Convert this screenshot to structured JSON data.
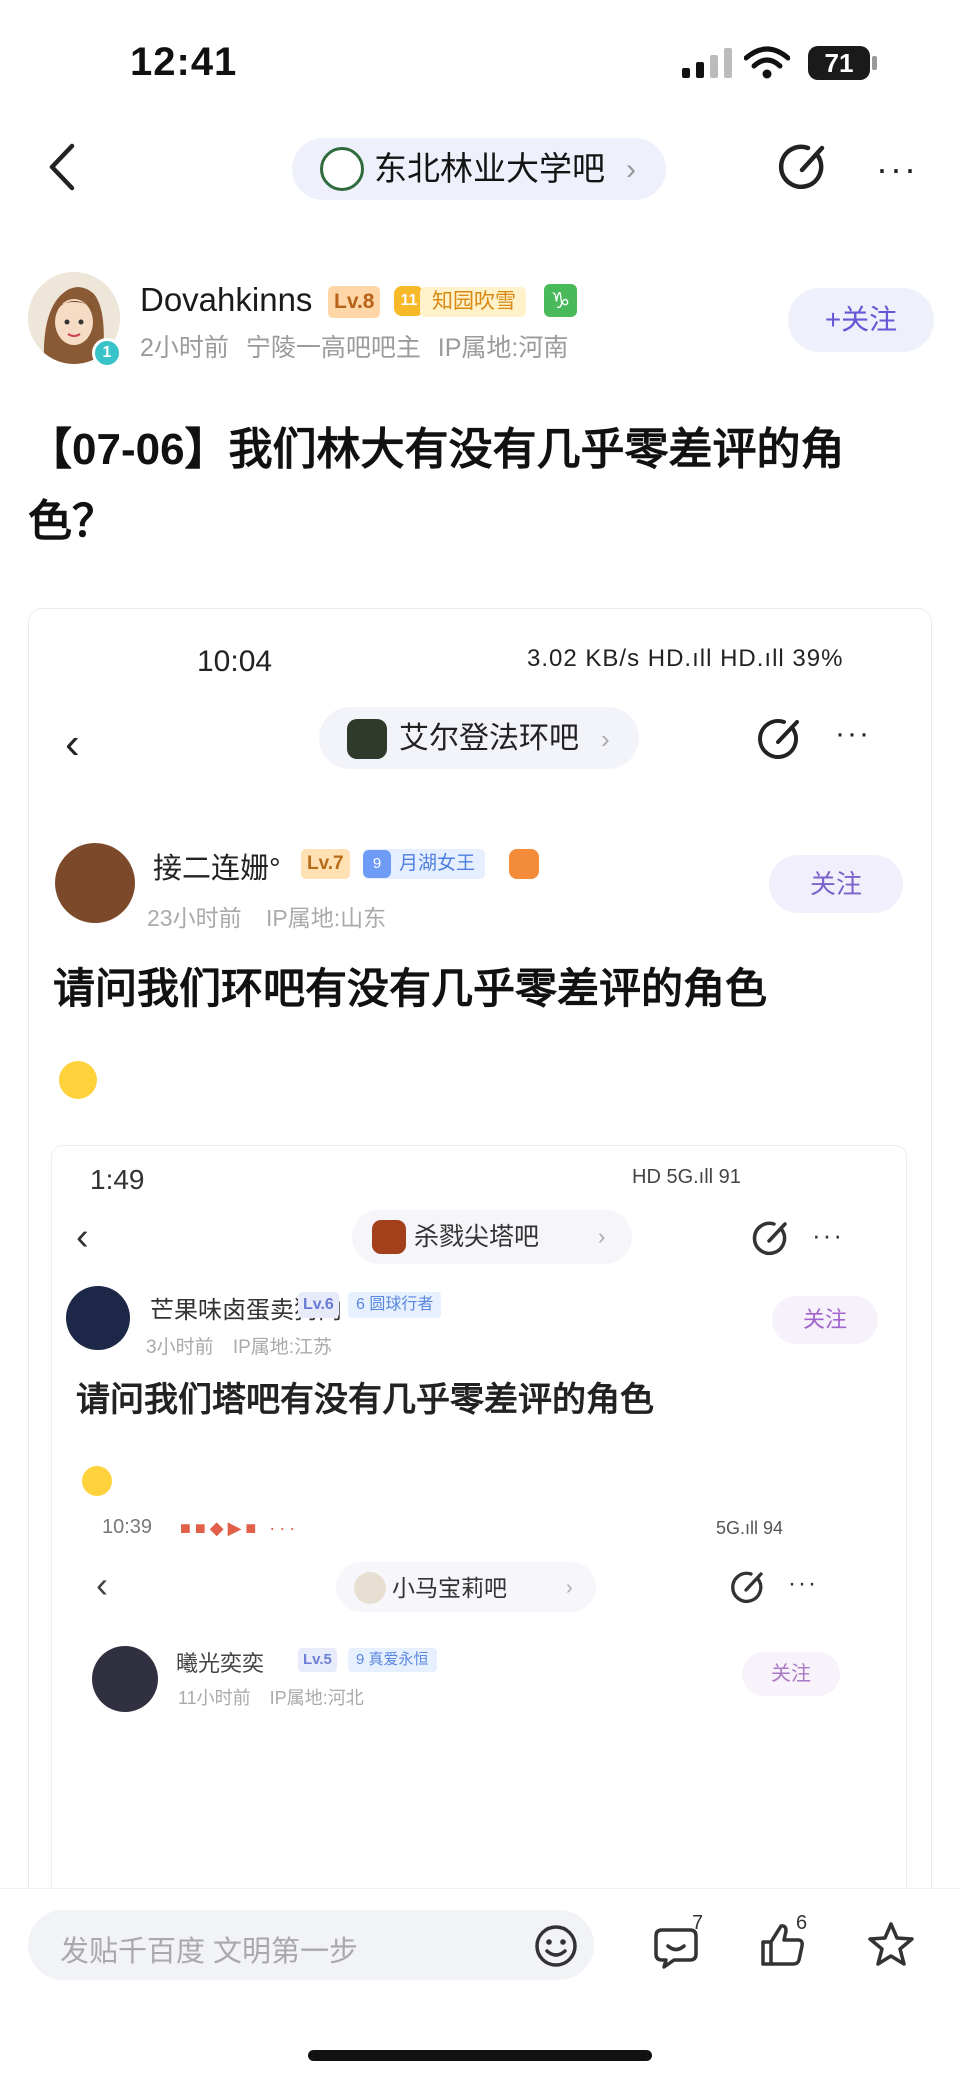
{
  "status_bar": {
    "time": "12:41",
    "battery": "71"
  },
  "nav": {
    "forum_name": "东北林业大学吧",
    "chevron": "›",
    "more": "···"
  },
  "author": {
    "name": "Dovahkinns",
    "level": "Lv.8",
    "medal_num": "11",
    "title_badge": "知园吹雪",
    "zodiac": "♑",
    "avatar_badge": "1",
    "meta": "2小时前  宁陵一高吧吧主  IP属地:河南",
    "follow_label": "+关注"
  },
  "post": {
    "title": "【07-06】我们林大有没有几乎零差评的角色？"
  },
  "screenshot1": {
    "time": "10:04",
    "status": "3.02 KB/s  HD.ıll HD.ıll  39%",
    "back": "‹",
    "forum_name": "艾尔登法环吧",
    "chevron": "›",
    "more": "···",
    "name": "接二连姗°",
    "level": "Lv.7",
    "tag_num": "9",
    "tag": "月湖女王",
    "meta": "23小时前 IP属地:山东",
    "follow_label": "关注",
    "title": "请问我们环吧有没有几乎零差评的角色"
  },
  "screenshot2": {
    "time": "1:49",
    "status": "HD 5G.ıll  91",
    "back": "‹",
    "forum_name": "杀戮尖塔吧",
    "chevron": "›",
    "more": "···",
    "name": "芒果味卤蛋卖狗肉",
    "level": "Lv.6",
    "tag": "6 圆球行者",
    "meta": "3小时前 IP属地:江苏",
    "follow_label": "关注",
    "title": "请问我们塔吧有没有几乎零差评的角色"
  },
  "screenshot3": {
    "time": "10:39",
    "apps": "■■◆▶■ ···",
    "status": "5G.ıll  94",
    "back": "‹",
    "forum_name": "小马宝莉吧",
    "chevron": "›",
    "more": "···",
    "name": "曦光奕奕",
    "level": "Lv.5",
    "tag": "9 真爱永恒",
    "meta": "11小时前 IP属地:河北",
    "follow_label": "关注"
  },
  "bottom_bar": {
    "input_placeholder": "发贴千百度 文明第一步",
    "comment_count": "7",
    "like_count": "6"
  }
}
